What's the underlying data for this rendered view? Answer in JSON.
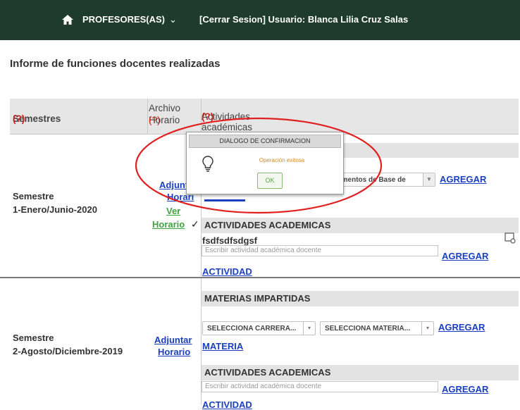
{
  "nav": {
    "menu": "PROFESORES(AS)",
    "caret": "⌄",
    "user": "[Cerrar Sesion] Usuario: Blanca Lilia Cruz Salas"
  },
  "page_title": "Informe de funciones docentes realizadas",
  "table": {
    "col_semestres": "Semestres",
    "col_archivo_1": "Archivo",
    "col_archivo_2": "Horario",
    "col_actividades": "Actividades académicas ó Materias impartidas",
    "help_mark": "(?)"
  },
  "semesters": [
    {
      "line1": "Semestre",
      "line2": "1-Enero/Junio-2020",
      "adjuntar_1": "Adjunt",
      "adjuntar_2": "Horari",
      "ver_1": "Ver",
      "ver_2": "Horario",
      "check": "✓",
      "materia_select": "damentos de Base de",
      "agregar": "AGREGAR",
      "actividades_header": "ACTIVIDADES ACADEMICAS",
      "activity_item": "fsdfsdfsdgsf",
      "activity_placeholder": "Escribir actividad académica docente",
      "agregar_actividad": "AGREGAR",
      "actividad_label": "ACTIVIDAD"
    },
    {
      "line1": "Semestre",
      "line2": "2-Agosto/Diciembre-2019",
      "adjuntar_1": "Adjuntar",
      "adjuntar_2": "Horario",
      "materias_header": "MATERIAS IMPARTIDAS",
      "carrera_select": "SELECCIONA CARRERA...",
      "materia_select": "SELECCIONA MATERIA...",
      "agregar": "AGREGAR",
      "materia_label": "MATERIA",
      "actividades_header": "ACTIVIDADES ACADEMICAS",
      "activity_placeholder": "Escribir actividad académica docente",
      "agregar_actividad": "AGREGAR",
      "actividad_label": "ACTIVIDAD"
    }
  ],
  "dialog": {
    "title": "DIALOGO DE CONFIRMACION",
    "message": "Operación exitosa",
    "ok": "OK"
  },
  "colors": {
    "navbar": "#1f3b2f",
    "link": "#1a3fbf",
    "link_green": "#3fa33f",
    "help": "#d02020",
    "annotation": "#e02020"
  },
  "icons": [
    "home-icon",
    "lightbulb-icon",
    "comment-icon",
    "chevron-down-icon"
  ]
}
